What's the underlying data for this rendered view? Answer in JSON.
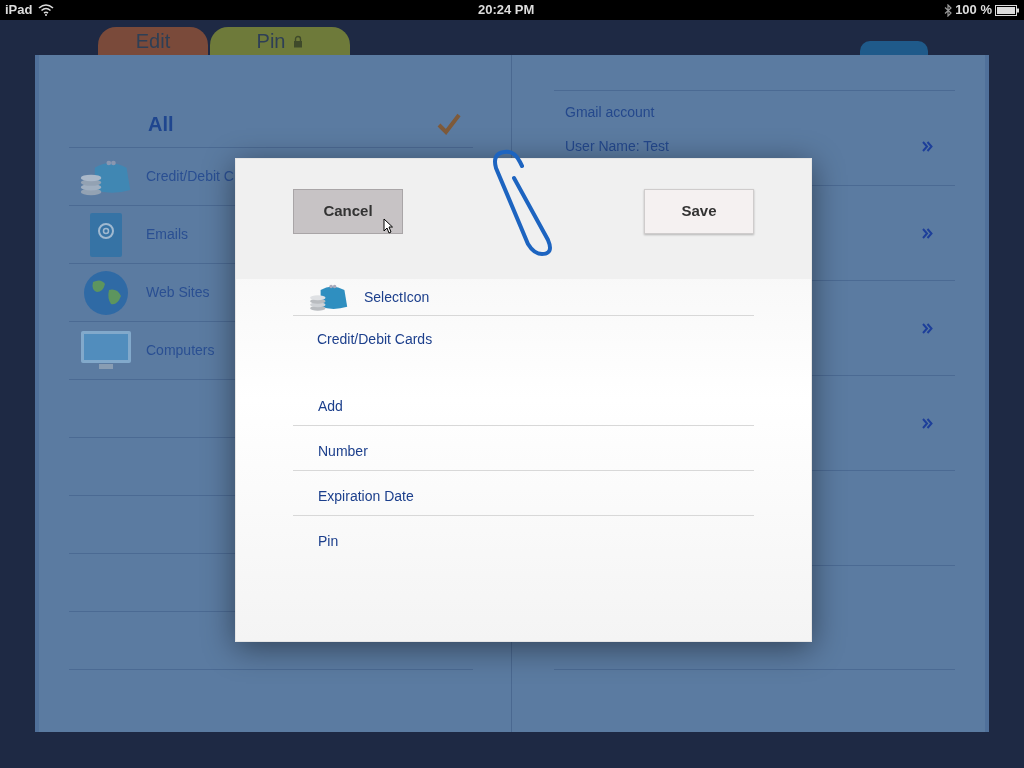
{
  "status_bar": {
    "device": "iPad",
    "time": "20:24 PM",
    "battery": "100 %"
  },
  "tabs": [
    {
      "label": "Edit",
      "kind": "edit"
    },
    {
      "label": "Pin",
      "kind": "pin"
    }
  ],
  "left_page": {
    "header": {
      "label": "All",
      "checked": true
    },
    "items": [
      {
        "label": "Credit/Debit C",
        "kind": "purse"
      },
      {
        "label": "Emails",
        "kind": "email"
      },
      {
        "label": "Web Sites",
        "kind": "globe"
      },
      {
        "label": "Computers",
        "kind": "monitor"
      }
    ]
  },
  "right_page": {
    "rows": [
      {
        "kind": "entry",
        "title": "Gmail account",
        "subtitle": "User Name: Test"
      },
      {
        "kind": "covered"
      },
      {
        "kind": "covered"
      },
      {
        "kind": "covered"
      }
    ]
  },
  "dialog": {
    "cancel": {
      "label": "Cancel",
      "selected": true
    },
    "save": {
      "label": "Save",
      "selected": false
    },
    "rows": [
      {
        "kind": "icon-picker",
        "label": "SelectIcon"
      },
      {
        "kind": "value",
        "label": "Credit/Debit Cards"
      },
      {
        "kind": "field",
        "label": "Add"
      },
      {
        "kind": "field",
        "label": "Number"
      },
      {
        "kind": "field",
        "label": "Expiration Date"
      },
      {
        "kind": "field",
        "label": "Pin"
      }
    ]
  }
}
